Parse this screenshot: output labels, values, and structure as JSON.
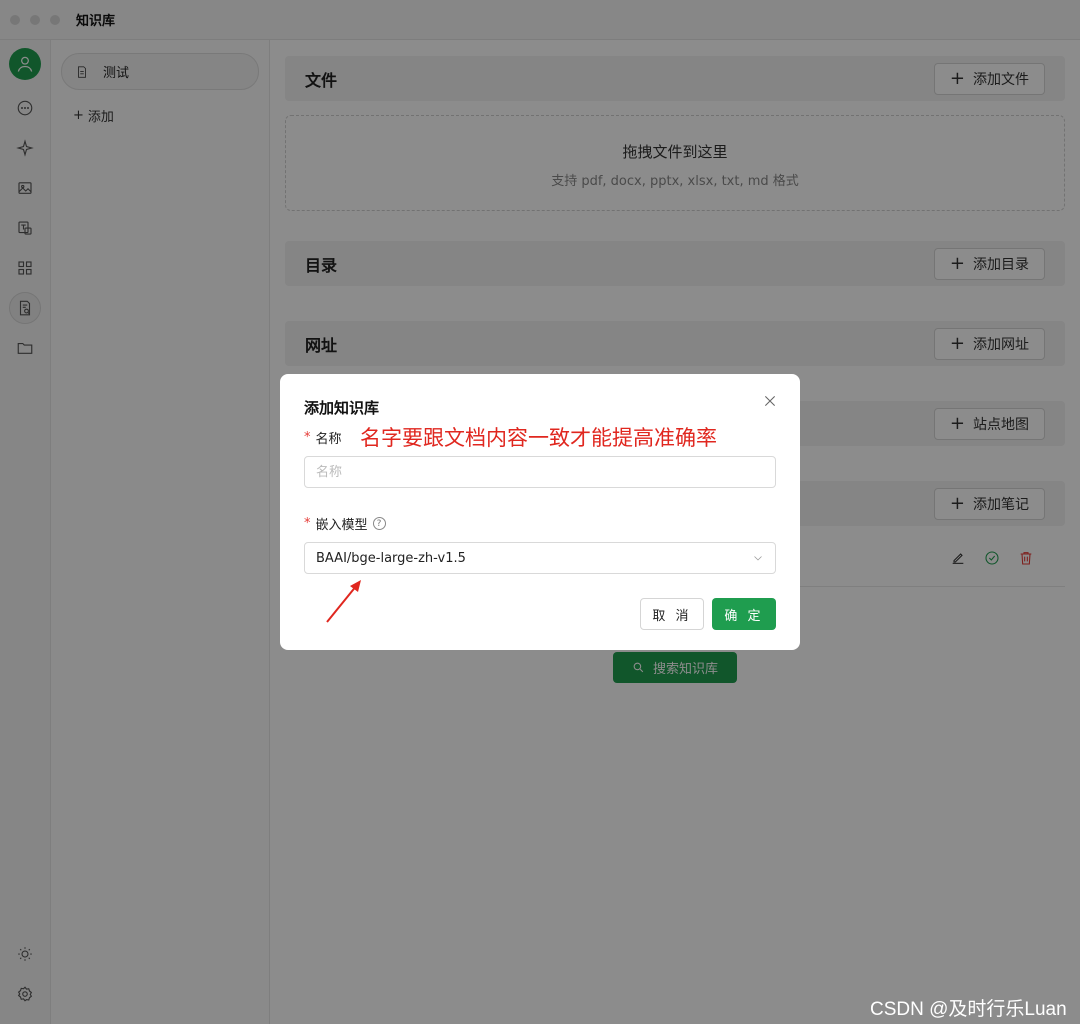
{
  "window": {
    "title": "知识库"
  },
  "icons": [
    "avatar-icon",
    "chat-icon",
    "sparkle-icon",
    "image-icon",
    "translate-icon",
    "apps-icon",
    "knowledge-icon",
    "folder-icon",
    "sun-icon",
    "settings-icon"
  ],
  "list": {
    "items": [
      {
        "label": "测试"
      }
    ],
    "add_label": "添加"
  },
  "main": {
    "files": {
      "title": "文件",
      "button": "添加文件"
    },
    "dropzone": {
      "title": "拖拽文件到这里",
      "subtitle": "支持 pdf, docx, pptx, xlsx, txt, md 格式"
    },
    "directories": {
      "title": "目录",
      "button": "添加目录"
    },
    "urls": {
      "title": "网址",
      "button": "添加网址"
    },
    "sitemap": {
      "button": "站点地图"
    },
    "notes": {
      "button": "添加笔记"
    },
    "search_button": "搜索知识库"
  },
  "modal": {
    "title": "添加知识库",
    "name_label": "名称",
    "name_placeholder": "名称",
    "name_value": "",
    "annotation": "名字要跟文档内容一致才能提高准确率",
    "model_label": "嵌入模型",
    "model_value": "BAAI/bge-large-zh-v1.5",
    "cancel": "取 消",
    "ok": "确 定"
  },
  "watermark": "CSDN @及时行乐Luan",
  "colors": {
    "accent": "#1f9d4f",
    "annotation": "#e0271f",
    "required": "#e53935"
  }
}
